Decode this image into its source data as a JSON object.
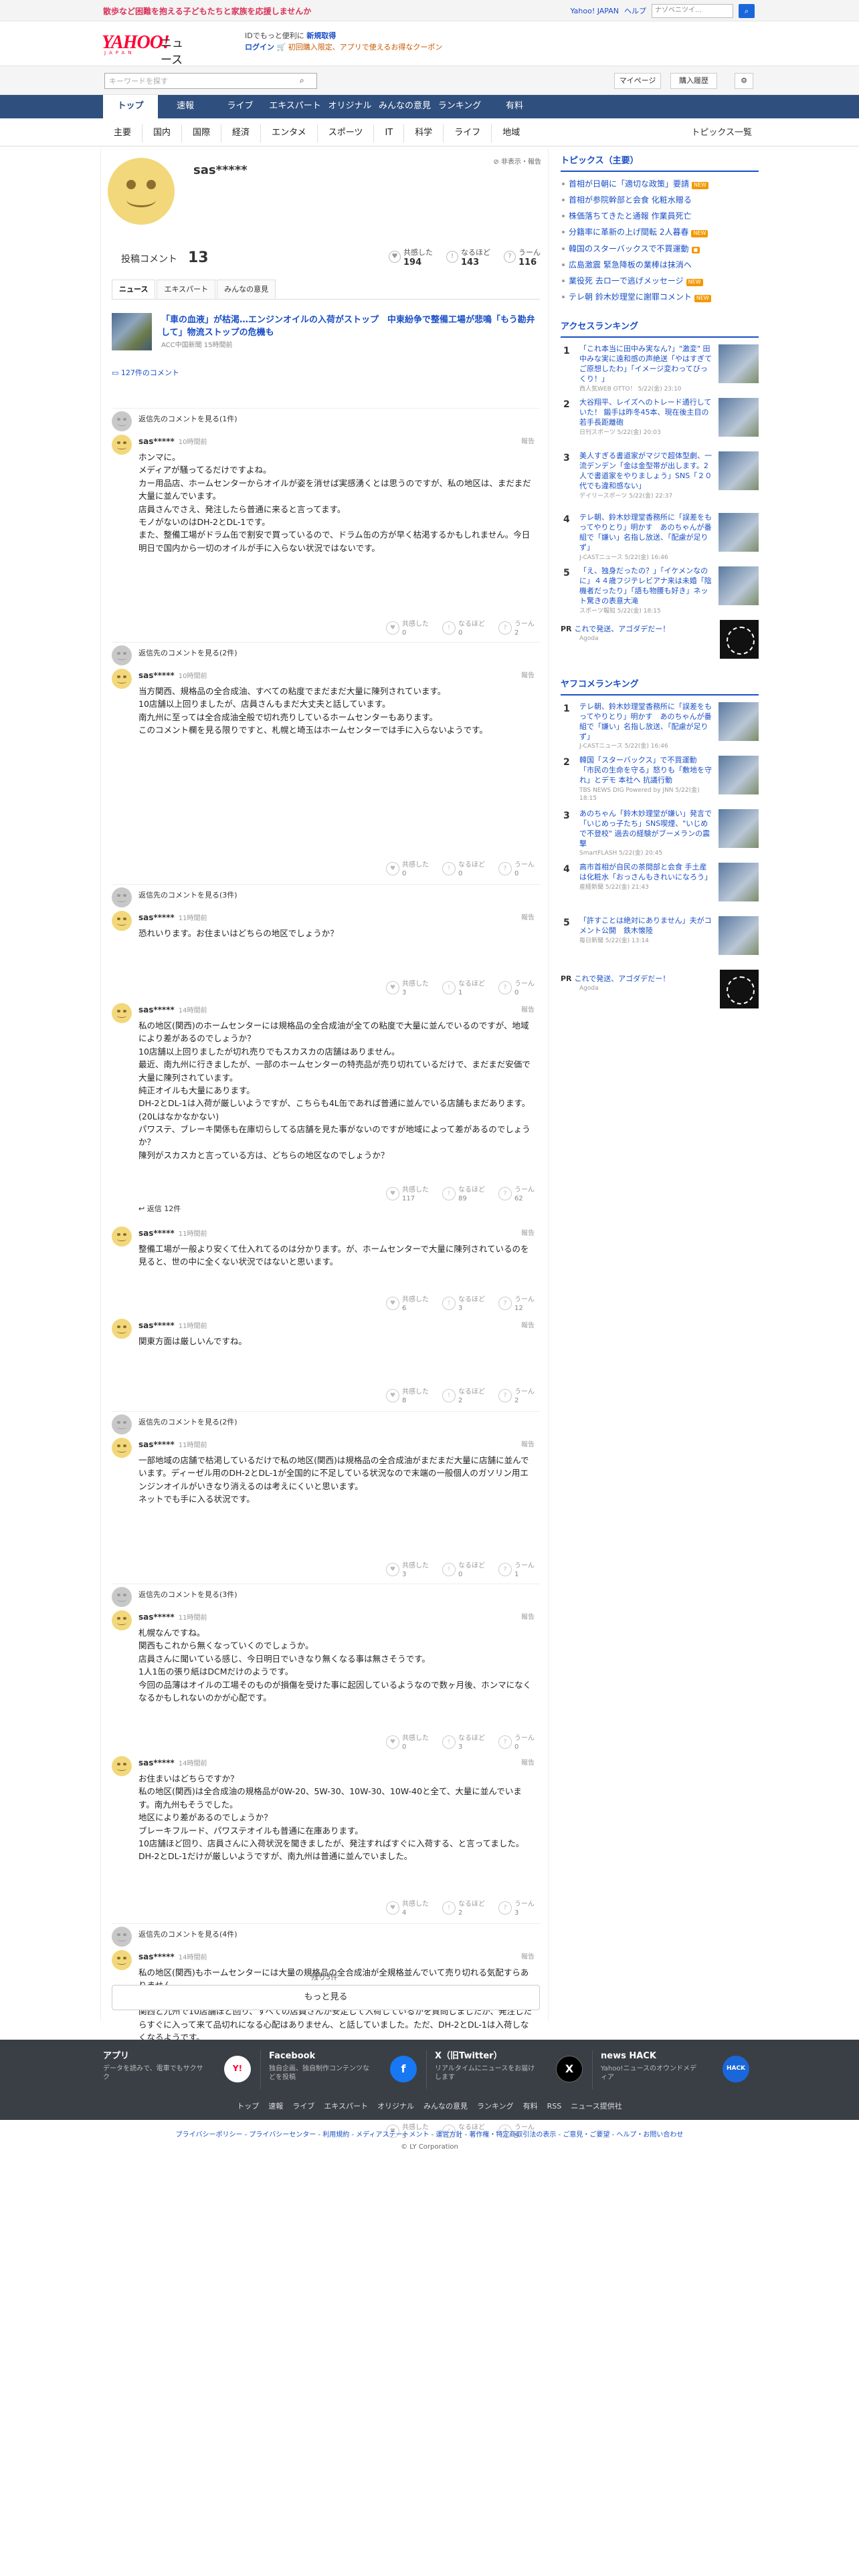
{
  "top": {
    "banner": "散歩など困難を抱える子どもたちと家族を応援しませんか",
    "links": [
      "Yahoo! JAPAN",
      "ヘルプ"
    ],
    "search_placeholder": "ウェブ検索",
    "search_value": "ナ​ゾ​ベ​ニ​ツ​イ​…"
  },
  "header": {
    "logo_text": "YAHOO!",
    "logo_sub": "JAPAN",
    "logo_service": "ニュース",
    "msg_line1_a": "IDでもっと便利に",
    "msg_line1_b": "新規取得",
    "msg_line2_a": "ログイン",
    "msg_line2_b": "初回購入限定、アプリで使えるお得なクーポン"
  },
  "searchbar": {
    "placeholder": "キーワードを探す",
    "mypage": "マイページ",
    "plan": "購入履歴"
  },
  "nav": [
    "トップ",
    "速報",
    "ライブ",
    "エキスパート",
    "オリジナル",
    "みんなの意見",
    "ランキング",
    "有料"
  ],
  "subnav": [
    "主要",
    "国内",
    "国際",
    "経済",
    "エンタメ",
    "スポーツ",
    "IT",
    "科学",
    "ライフ",
    "地域"
  ],
  "topics_all": "トピックス一覧",
  "profile": {
    "name": "sas*****",
    "block": "非表示・報告",
    "post_label": "投稿コメント",
    "post_count": "13",
    "stats": [
      {
        "label": "共感した",
        "value": "194"
      },
      {
        "label": "なるほど",
        "value": "143"
      },
      {
        "label": "うーん",
        "value": "116"
      }
    ],
    "tabs": [
      "ニュース",
      "エキスパート",
      "みんなの意見"
    ]
  },
  "article": {
    "title": "「車の血液」が枯渇…エンジンオイルの入荷がストップ　中東紛争で整備工場が悲鳴「もう勘弁して」物流ストップの危機も",
    "meta": "ACC中国新聞 15時間前"
  },
  "comment_count": "127件のコメント",
  "threads": [
    {
      "parent": "返信先のコメントを見る(1件)",
      "comments": [
        {
          "user": "sas*****",
          "time": "10時間前",
          "text": "ホンマに。\nメディアが騒ってるだけですよね。\nカー用品店、ホームセンターからオイルが姿を消せば実感湧くとは思うのですが、私の地区は、まだまだ大量に並んでいます。\n店員さんでさえ、発注したら普通に来ると言ってます。\nモノがないのはDH-2とDL-1です。\nまた、整備工場がドラム缶で割安で買っているので、ドラム缶の方が早く枯渇するかもしれません。今日明日で国内から一切のオイルが手に入らない状況ではないです。",
          "votes": [
            "0",
            "0",
            "2"
          ]
        }
      ]
    },
    {
      "parent": "返信先のコメントを見る(2件)",
      "comments": [
        {
          "user": "sas*****",
          "time": "10時間前",
          "text": "当方関西、規格品の全合成油、すべての粘度でまだまだ大量に陳列されています。\n10店舗以上回りましたが、店員さんもまだ大丈夫と話しています。\n南九州に至っては全合成油全般で切れ売りしているホームセンターもあります。\nこのコメント欄を見る限りですと、札幌と埼玉はホームセンターでは手に入らないようです。",
          "votes": [
            "0",
            "0",
            "0"
          ]
        }
      ]
    },
    {
      "parent": "返信先のコメントを見る(3件)",
      "comments": [
        {
          "user": "sas*****",
          "time": "11時間前",
          "text": "恐れいります。お住まいはどちらの地区でしょうか？",
          "votes": [
            "3",
            "1",
            "0"
          ]
        },
        {
          "user": "sas*****",
          "time": "14時間前",
          "text": "私の地区(関西)のホームセンターには規格品の全合成油が全ての粘度で大量に並んでいるのですが、地域により差があるのでしょうか？\n10店舗以上回りましたが切れ売りでもスカスカの店舗はありません。\n最近、南九州に行きましたが、一部のホームセンターの特売品が売り切れているだけで、まだまだ安価で大量に陳列されています。\n純正オイルも大量にあります。\nDH-2とDL-1は入荷が厳しいようですが、こちらも4L缶であれば普通に並んでいる店舗もまだあります。(20Lはなかなかない)\nパワステ、ブレーキ関係も在庫切らしてる店舗を見た事がないのですが地域によって差があるのでしょうか？\n陳列がスカスカと言っている方は、どちらの地区なのでしょうか？",
          "votes": [
            "117",
            "89",
            "62"
          ],
          "reply": "返信 12件"
        },
        {
          "user": "sas*****",
          "time": "11時間前",
          "text": "整備工場が一般より安くて仕入れてるのは分かります。が、ホームセンターで大量に陳列されているのを見ると、世の中に全くない状況ではないと思います。",
          "votes": [
            "6",
            "3",
            "12"
          ]
        },
        {
          "user": "sas*****",
          "time": "11時間前",
          "text": "関東方面は厳しいんですね。",
          "votes": [
            "8",
            "2",
            "2"
          ]
        }
      ]
    },
    {
      "parent": "返信先のコメントを見る(2件)",
      "comments": [
        {
          "user": "sas*****",
          "time": "11時間前",
          "text": "一部地域の店舗で枯渇しているだけで私の地区(関西)は規格品の全合成油がまだまだ大量に店舗に並んでいます。ディーゼル用のDH-2とDL-1が全国的に不足している状況なので末端の一般個人のガソリン用エンジンオイルがいきなり消えるのは考えにくいと思います。\nネットでも手に入る状況です。",
          "votes": [
            "3",
            "0",
            "1"
          ]
        }
      ]
    },
    {
      "parent": "返信先のコメントを見る(3件)",
      "comments": [
        {
          "user": "sas*****",
          "time": "11時間前",
          "text": "札幌なんですね。\n関西もこれから無くなっていくのでしょうか。\n店員さんに聞いている感じ、今日明日でいきなり無くなる事は無さそうです。\n1人1缶の張り紙はDCMだけのようです。\n今回の品薄はオイルの工場そのものが損傷を受けた事に起因しているようなので数ヶ月後、ホンマになくなるかもしれないのかが心配です。",
          "votes": [
            "0",
            "3",
            "0"
          ]
        },
        {
          "user": "sas*****",
          "time": "14時間前",
          "text": "お住まいはどちらですか？\n私の地区(関西)は全合成油の規格品が0W-20、5W-30、10W-30、10W-40と全て、大量に並んでいます。南九州もそうでした。\n地区により差があるのでしょうか？\nブレーキフルード、パワステオイルも普通に在庫あります。\n10店舗ほど回り、店員さんに入荷状況を聞きましたが、発注すればすぐに入荷する、と言ってました。\nDH-2とDL-1だけが厳しいようですが、南九州は普通に並んでいました。",
          "votes": [
            "4",
            "2",
            "3"
          ]
        }
      ]
    },
    {
      "parent": "返信先のコメントを見る(4件)",
      "comments": [
        {
          "user": "sas*****",
          "time": "14時間前",
          "text": "私の地区(関西)もホームセンターには大量の規格品の全合成油が全規格並んでいて売り切れる気配すらありません。\n南九州に最近行きましたが同じくです。\n関西と九州で10店舗ほど回り、すべての店員さんが安定して入荷しているかを質問しましたが、発注したらすぐに入って来て品切れになる心配はありません、と話していました。ただ、DH-2とDL-1は入荷しなくなるようです。",
          "votes": [
            "5",
            "1",
            "5"
          ]
        }
      ]
    }
  ],
  "remaining": "残り3件",
  "more": "もっと見る",
  "vote_labels": [
    "共感した",
    "なるほど",
    "うーん"
  ],
  "side": {
    "topics_head": "トピックス（主要）",
    "topics": [
      {
        "text": "首相が日朝に「適切な政策」要請",
        "badge": "NEW"
      },
      {
        "text": "首相が参院幹部と会食 化粧水贈る",
        "badge": ""
      },
      {
        "text": "株価落ちてきたと通報 作業員死亡",
        "badge": ""
      },
      {
        "text": "分籍率に革新の上げ間転 2人暮春",
        "badge": "NEW"
      },
      {
        "text": "韓国のスターバックスで不買運動",
        "badge": "◼"
      },
      {
        "text": "広島激震 緊急降板の業棒は抹消へ",
        "badge": ""
      },
      {
        "text": "業役死 去ロ一で逃げメッセージ",
        "badge": "NEW"
      },
      {
        "text": "テレ朝 鈴木妙理堂に謝罪コメント",
        "badge": "NEW"
      }
    ],
    "access_head": "アクセスランキング",
    "access": [
      {
        "rank": "1",
        "title": "「これ本当に田中み実なん?」\"激変\" 田中みな実に遠和感の声絶送「やはすぎてご原想したわ」「イメージ変わってびっくり！」",
        "src": "西人気WEB OTTO！ 5/22(金) 23:10"
      },
      {
        "rank": "2",
        "title": "大谷翔平、レイズへのトレード通行していた！ 鍛手は昨冬45本、現在後主目の若手長距離砲",
        "src": "日刊スポーツ 5/22(金) 20:03"
      },
      {
        "rank": "3",
        "title": "美人すぎる書道家がマジで超体型劇、一流デンデン「金は金型帯が出します。2人で書道家をやりましょう」SNS「２０代でも違和感ない」",
        "src": "デイリースポーツ 5/22(金) 22:37"
      },
      {
        "rank": "4",
        "title": "テレ朝、鈴木妙理堂香務所に「誤差をもってやりとり」明かす　あのちゃんが番組で「嫌い」名指し放送、「配慮が足りず」",
        "src": "J-CASTニュース 5/22(金) 16:46"
      },
      {
        "rank": "5",
        "title": "「え、独身だったの？」「イケメンなのに」４４歳フジテレビアナ来は未婚「陰機者だったり」「語も物腰も好き」ネット驚きの表意大滝",
        "src": "スポーツ報知 5/22(金) 18:15"
      }
    ],
    "pr1": {
      "label": "PR",
      "title": "これで発送、アゴダデだー！",
      "adv": "Agoda"
    },
    "yafuko_head": "ヤフコメランキング",
    "yafuko": [
      {
        "rank": "1",
        "title": "テレ朝、鈴木妙理堂香務所に「誤差をもってやりとり」明かす　あのちゃんが番組で「嫌い」名指し放送、「配慮が足りず」",
        "src": "J-CASTニュース 5/22(金) 16:46"
      },
      {
        "rank": "2",
        "title": "韓国「スターバックス」で不買運動 「市民の生命を守る」怒りも「敷地を守れ」とデモ 本社へ 抗議行動",
        "src": "TBS NEWS DIG Powered by JNN 5/22(金) 18:15"
      },
      {
        "rank": "3",
        "title": "あのちゃん「鈴木妙理堂が嫌い」発言で「いじめっ子たち」SNS喫煙、\"いじめで不登校\" 過去の経験がブーメランの震撃",
        "src": "SmartFLASH 5/22(金) 20:45"
      },
      {
        "rank": "4",
        "title": "高市首相が自民の茶間部と会食 手土産は化粧水「おっさんもきれいになろう」",
        "src": "産経新聞 5/22(金) 21:43"
      },
      {
        "rank": "5",
        "title": "「許すことは絶対にありません」夫がコメント公開　鉄木懐陸",
        "src": "毎日新聞 5/22(金) 13:14"
      }
    ],
    "pr2": {
      "label": "PR",
      "title": "これで発送、アゴダデだー！",
      "adv": "Agoda"
    }
  },
  "footer": {
    "cols": [
      {
        "title": "アプリ",
        "desc": "データを読みで、電車でもサクサク",
        "icon": "Y!"
      },
      {
        "title": "Facebook",
        "desc": "独自企画、独自制作コンテンツなどを投稿",
        "icon": "f"
      },
      {
        "title": "X（旧Twitter）",
        "desc": "リアルタイムにニュースをお届けします",
        "icon": "X"
      },
      {
        "title": "news HACK",
        "desc": "Yahoo!ニュースのオウンドメディア",
        "icon": "HACK"
      }
    ],
    "links": [
      "トップ",
      "速報",
      "ライブ",
      "エキスパート",
      "オリジナル",
      "みんなの意見",
      "ランキング",
      "有料",
      "RSS",
      "ニュース提供社"
    ],
    "legal": "プライバシーポリシー - プライバシーセンター - 利用規約 - メディアステートメント - 運営方針 - 著作権・特定商取引法の表示 - ご意見・ご要望 - ヘルプ・お問い合わせ",
    "copyright": "© LY Corporation"
  }
}
